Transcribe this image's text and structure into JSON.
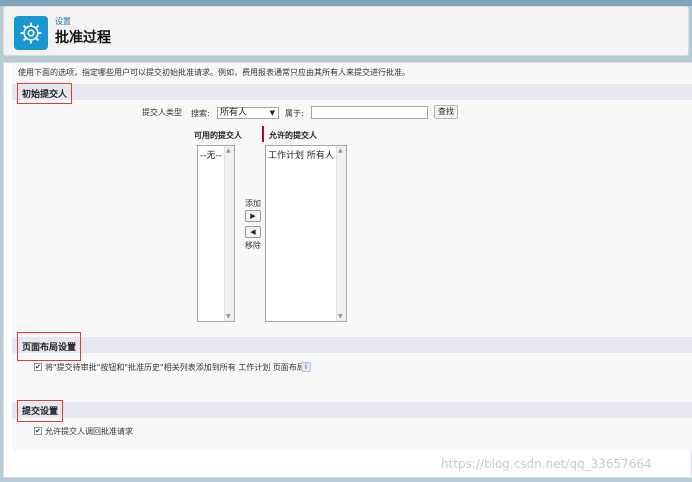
{
  "header": {
    "breadcrumb": "设置",
    "title": "批准过程",
    "icon": "gear-icon",
    "icon_color": "#1b96d5"
  },
  "intro_text": "使用下面的选项，指定哪些用户可以提交初始批准请求。例如，费用报表通常只应由其所有人来提交进行批准。",
  "initial_submitters": {
    "section_title": "初始提交人",
    "submitter_type_label": "提交人类型",
    "search_label": "搜索:",
    "search_selected": "所有人",
    "belongs_label": "属于:",
    "belongs_value": "",
    "find_button": "查找",
    "available_header": "可用的提交人",
    "allowed_header": "允许的提交人",
    "available_items": [
      "--无--"
    ],
    "allowed_items": [
      "工作计划 所有人"
    ],
    "add_label": "添加",
    "remove_label": "移除"
  },
  "page_layout": {
    "section_title": "页面布局设置",
    "checkbox_label": "将\"提交待审批\"按钮和\"批准历史\"相关列表添加到所有 工作计划 页面布局",
    "checked": true
  },
  "submission": {
    "section_title": "提交设置",
    "checkbox_label": "允许提交人调回批准请求",
    "checked": true
  },
  "watermark": "https://blog.csdn.net/qq_33657664",
  "colors": {
    "section_bar": "#e6e7ef",
    "highlight_box": "#e23b3b",
    "breadcrumb": "#1b6fb0"
  }
}
